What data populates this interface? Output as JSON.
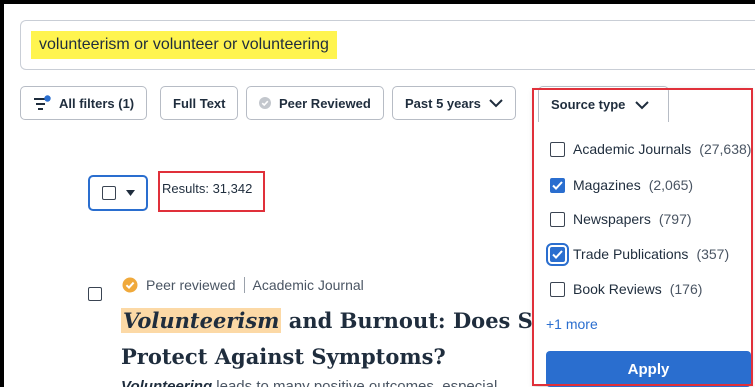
{
  "search": {
    "query": "volunteerism or volunteer or volunteering"
  },
  "filters": {
    "all_filters": "All filters (1)",
    "full_text": "Full Text",
    "peer_reviewed": "Peer Reviewed",
    "date_range": "Past 5 years",
    "source_type": "Source type"
  },
  "results": {
    "count_label": "Results: 31,342"
  },
  "result_item": {
    "badge": "Peer reviewed",
    "doc_type": "Academic Journal",
    "title_highlight": "Volunteerism",
    "title_rest": " and Burnout: Does Satisfa",
    "title_line2": "Protect Against Symptoms?",
    "snippet_highlight": "Volunteering",
    "snippet_rest": " leads to many positive outcomes, especial"
  },
  "source_type_panel": {
    "options": [
      {
        "label": "Academic Journals",
        "count": "(27,638)",
        "checked": false
      },
      {
        "label": "Magazines",
        "count": "(2,065)",
        "checked": true
      },
      {
        "label": "Newspapers",
        "count": "(797)",
        "checked": false
      },
      {
        "label": "Trade Publications",
        "count": "(357)",
        "checked": true
      },
      {
        "label": "Book Reviews",
        "count": "(176)",
        "checked": false
      }
    ],
    "more_label": "+1 more",
    "apply_label": "Apply"
  },
  "colors": {
    "accent": "#2a6ecf",
    "highlight_query": "#fff44f",
    "highlight_term": "#fcd9a6",
    "annotation": "#e0303a",
    "peer_badge": "#f0a93b"
  }
}
